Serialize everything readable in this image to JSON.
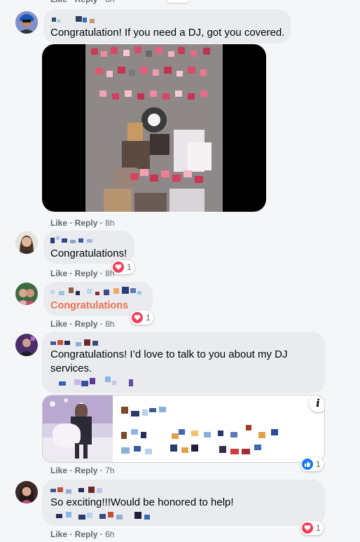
{
  "meta_labels": {
    "like": "Like",
    "reply": "Reply",
    "separator": "·"
  },
  "comments": [
    {
      "time": "8h",
      "text": "Congratulation! If you need a DJ, got you covered."
    },
    {
      "time": "8h"
    },
    {
      "time": "8h",
      "text": "Congratulations!",
      "reaction_count": "1",
      "reaction": "love"
    },
    {
      "time": "8h",
      "text": "Congratulations",
      "text_color": "#f0714f",
      "reaction_count": "1",
      "reaction": "love"
    },
    {
      "time": "7h",
      "text": "Congratulations! I’d love to talk to you about my DJ services.",
      "reaction_count": "1",
      "reaction": "like",
      "link_card_info_icon": "i"
    },
    {
      "time": "6h",
      "text": "So exciting!!!Would be honored to help!",
      "reaction_count": "1",
      "reaction": "love"
    }
  ],
  "colors": {
    "love": "#f33e58",
    "like": "#1877f2",
    "meta": "#65676b",
    "bubble": "#e9ebee"
  }
}
